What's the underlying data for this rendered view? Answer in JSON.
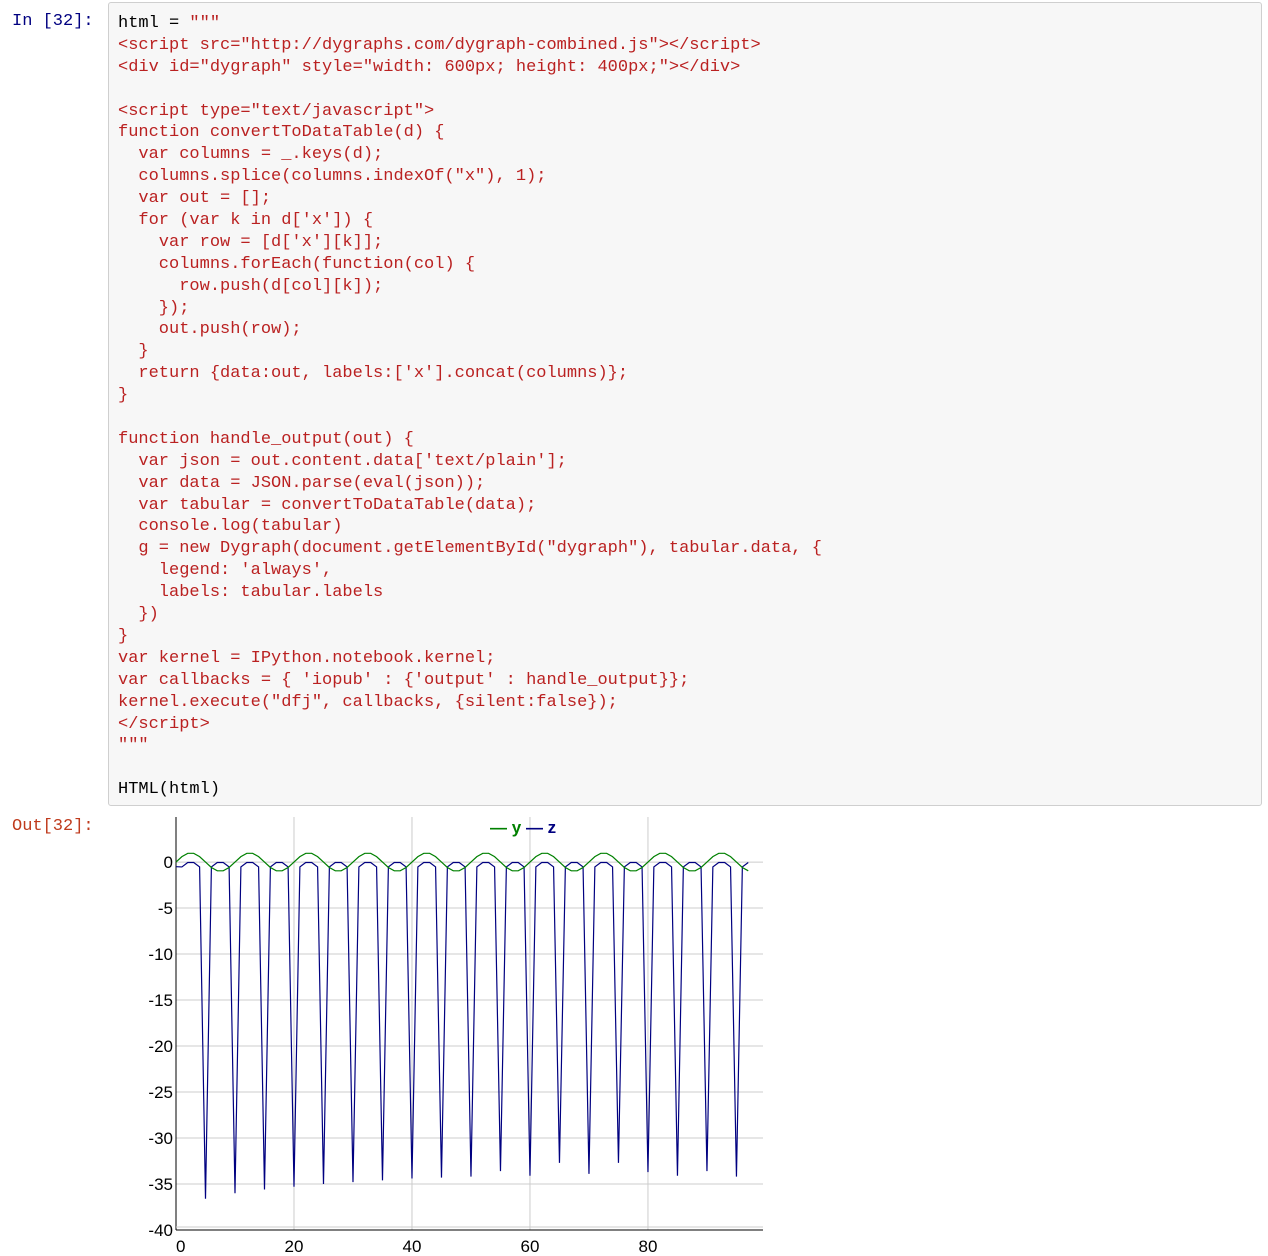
{
  "input_prompt": "In [32]:",
  "output_prompt": "Out[32]:",
  "code": {
    "assign_prefix": "html = ",
    "lines": [
      "\"\"\"",
      "<script src=\"http://dygraphs.com/dygraph-combined.js\"></script>",
      "<div id=\"dygraph\" style=\"width: 600px; height: 400px;\"></div>",
      "",
      "<script type=\"text/javascript\">",
      "function convertToDataTable(d) {",
      "  var columns = _.keys(d);",
      "  columns.splice(columns.indexOf(\"x\"), 1);",
      "  var out = [];",
      "  for (var k in d['x']) {",
      "    var row = [d['x'][k]];",
      "    columns.forEach(function(col) {",
      "      row.push(d[col][k]);",
      "    });",
      "    out.push(row);",
      "  }",
      "  return {data:out, labels:['x'].concat(columns)};",
      "}",
      "",
      "function handle_output(out) {",
      "  var json = out.content.data['text/plain'];",
      "  var data = JSON.parse(eval(json));",
      "  var tabular = convertToDataTable(data);",
      "  console.log(tabular)",
      "  g = new Dygraph(document.getElementById(\"dygraph\"), tabular.data, {",
      "    legend: 'always',",
      "    labels: tabular.labels",
      "  })",
      "}",
      "var kernel = IPython.notebook.kernel;",
      "var callbacks = { 'iopub' : {'output' : handle_output}};",
      "kernel.execute(\"dfj\", callbacks, {silent:false});",
      "</script>",
      "\"\"\"",
      ""
    ],
    "call": "HTML(html)"
  },
  "chart_data": {
    "type": "line",
    "title": "",
    "xlabel": "",
    "ylabel": "",
    "xlim": [
      0,
      99.5
    ],
    "ylim": [
      -40,
      4.9
    ],
    "xticks": [
      "0",
      "20",
      "40",
      "60",
      "80"
    ],
    "yticks": [
      "0",
      "-5",
      "-10",
      "-15",
      "-20",
      "-25",
      "-30",
      "-35",
      "-40"
    ],
    "grid": true,
    "legend_placement": "top-center",
    "series_y_pattern_per_x_mod_10": [
      0,
      0.59,
      0.95,
      0.95,
      0.59,
      0,
      -0.59,
      -0.95,
      -0.95,
      -0.59
    ],
    "series": [
      {
        "name": "y",
        "color": "#008000"
      },
      {
        "name": "z",
        "color": "#000080"
      }
    ],
    "z_dips": {
      "x": [
        5,
        10,
        15,
        20,
        25,
        30,
        35,
        40,
        45,
        50,
        55,
        60,
        65,
        70,
        75,
        80,
        85,
        90,
        95
      ],
      "values": [
        -36.6,
        -36,
        -35.6,
        -35.3,
        -35,
        -34.8,
        -34.6,
        -34.4,
        -34.3,
        -34.2,
        -33.6,
        -34.1,
        -32.7,
        -33.9,
        -32.7,
        -33.7,
        -34.1,
        -33.6,
        -34.2
      ]
    },
    "z_between_dips_pattern_per_x_mod_5": [
      null,
      -0.53,
      -0.05,
      -0.05,
      -0.53
    ],
    "x_range_points": [
      0,
      97
    ]
  }
}
